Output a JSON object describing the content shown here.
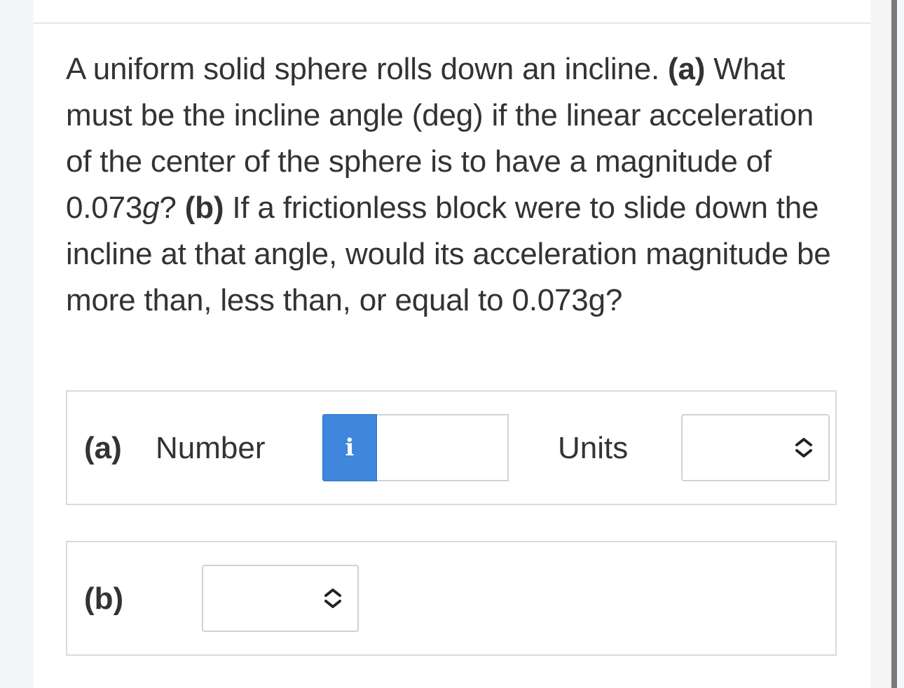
{
  "question": {
    "intro": "A uniform solid sphere rolls down an incline.",
    "part_a_marker": "(a)",
    "part_a_text_1": "What must be the incline angle (deg) if the linear acceleration of the center of the sphere is to have a magnitude of 0.073",
    "g_symbol": "g",
    "part_a_text_2": "?",
    "part_b_marker": "(b)",
    "part_b_text": "If a frictionless block were to slide down the incline at that angle, would its acceleration magnitude be more than, less than, or equal to 0.073g?"
  },
  "answer_a": {
    "part_label": "(a)",
    "number_label": "Number",
    "info_icon_glyph": "i",
    "number_value": "",
    "units_label": "Units",
    "units_selected": ""
  },
  "answer_b": {
    "part_label": "(b)",
    "selected": ""
  },
  "icons": {
    "info": "info-icon",
    "select_chevron": "chevron-up-down-icon"
  },
  "colors": {
    "info_button": "#3f86dc",
    "border": "#d8dbe0",
    "text": "#333333"
  }
}
